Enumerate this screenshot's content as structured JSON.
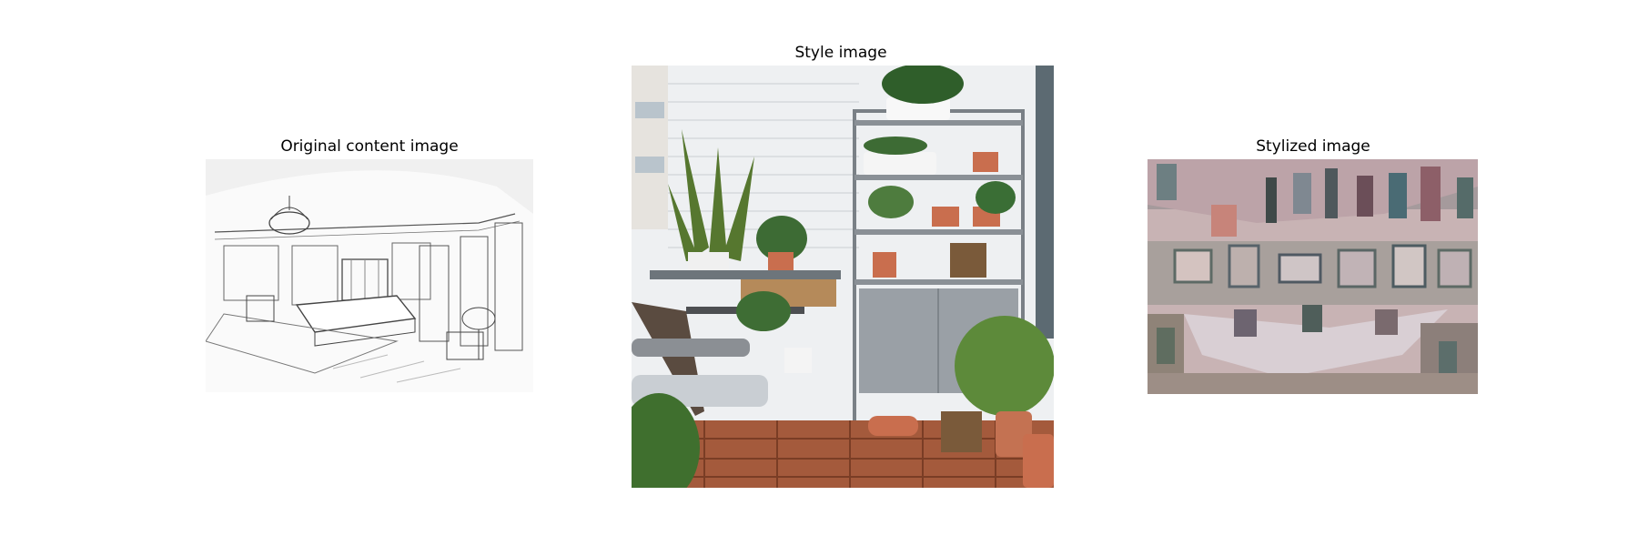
{
  "panels": [
    {
      "title": "Original content image",
      "image": "bedroom-line-sketch"
    },
    {
      "title": "Style image",
      "image": "balcony-plant-shelf-photo"
    },
    {
      "title": "Stylized image",
      "image": "stylized-bedroom-collage"
    }
  ]
}
